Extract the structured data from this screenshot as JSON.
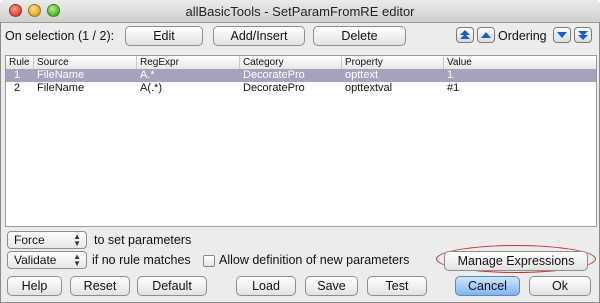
{
  "window": {
    "title": "allBasicTools - SetParamFromRE editor"
  },
  "toolbar": {
    "selection_label": "On selection (1 / 2):",
    "edit_label": "Edit",
    "add_label": "Add/Insert",
    "delete_label": "Delete",
    "ordering_label": "Ordering"
  },
  "table": {
    "headers": [
      "Rule",
      "Source",
      "RegExpr",
      "Category",
      "Property",
      "Value"
    ],
    "rows": [
      {
        "rule": "1",
        "source": "FileName",
        "regexpr": "A.*",
        "category": "DecoratePro",
        "property": "opttext",
        "value": "1",
        "selected": true
      },
      {
        "rule": "2",
        "source": "FileName",
        "regexpr": "A(.*)",
        "category": "DecoratePro",
        "property": "opttextval",
        "value": "#1",
        "selected": false
      }
    ]
  },
  "options": {
    "force_select": "Force",
    "force_suffix": "to set parameters",
    "validate_select": "Validate",
    "validate_suffix": "if no rule matches",
    "allow_label": "Allow definition of new parameters",
    "manage_label": "Manage Expressions"
  },
  "footer": {
    "help": "Help",
    "reset": "Reset",
    "default": "Default",
    "load": "Load",
    "save": "Save",
    "test": "Test",
    "cancel": "Cancel",
    "ok": "Ok"
  },
  "colors": {
    "selection_row": "#a6a1bd",
    "accent_blue": "#1a5fd0",
    "highlight_ring": "#c03030"
  }
}
